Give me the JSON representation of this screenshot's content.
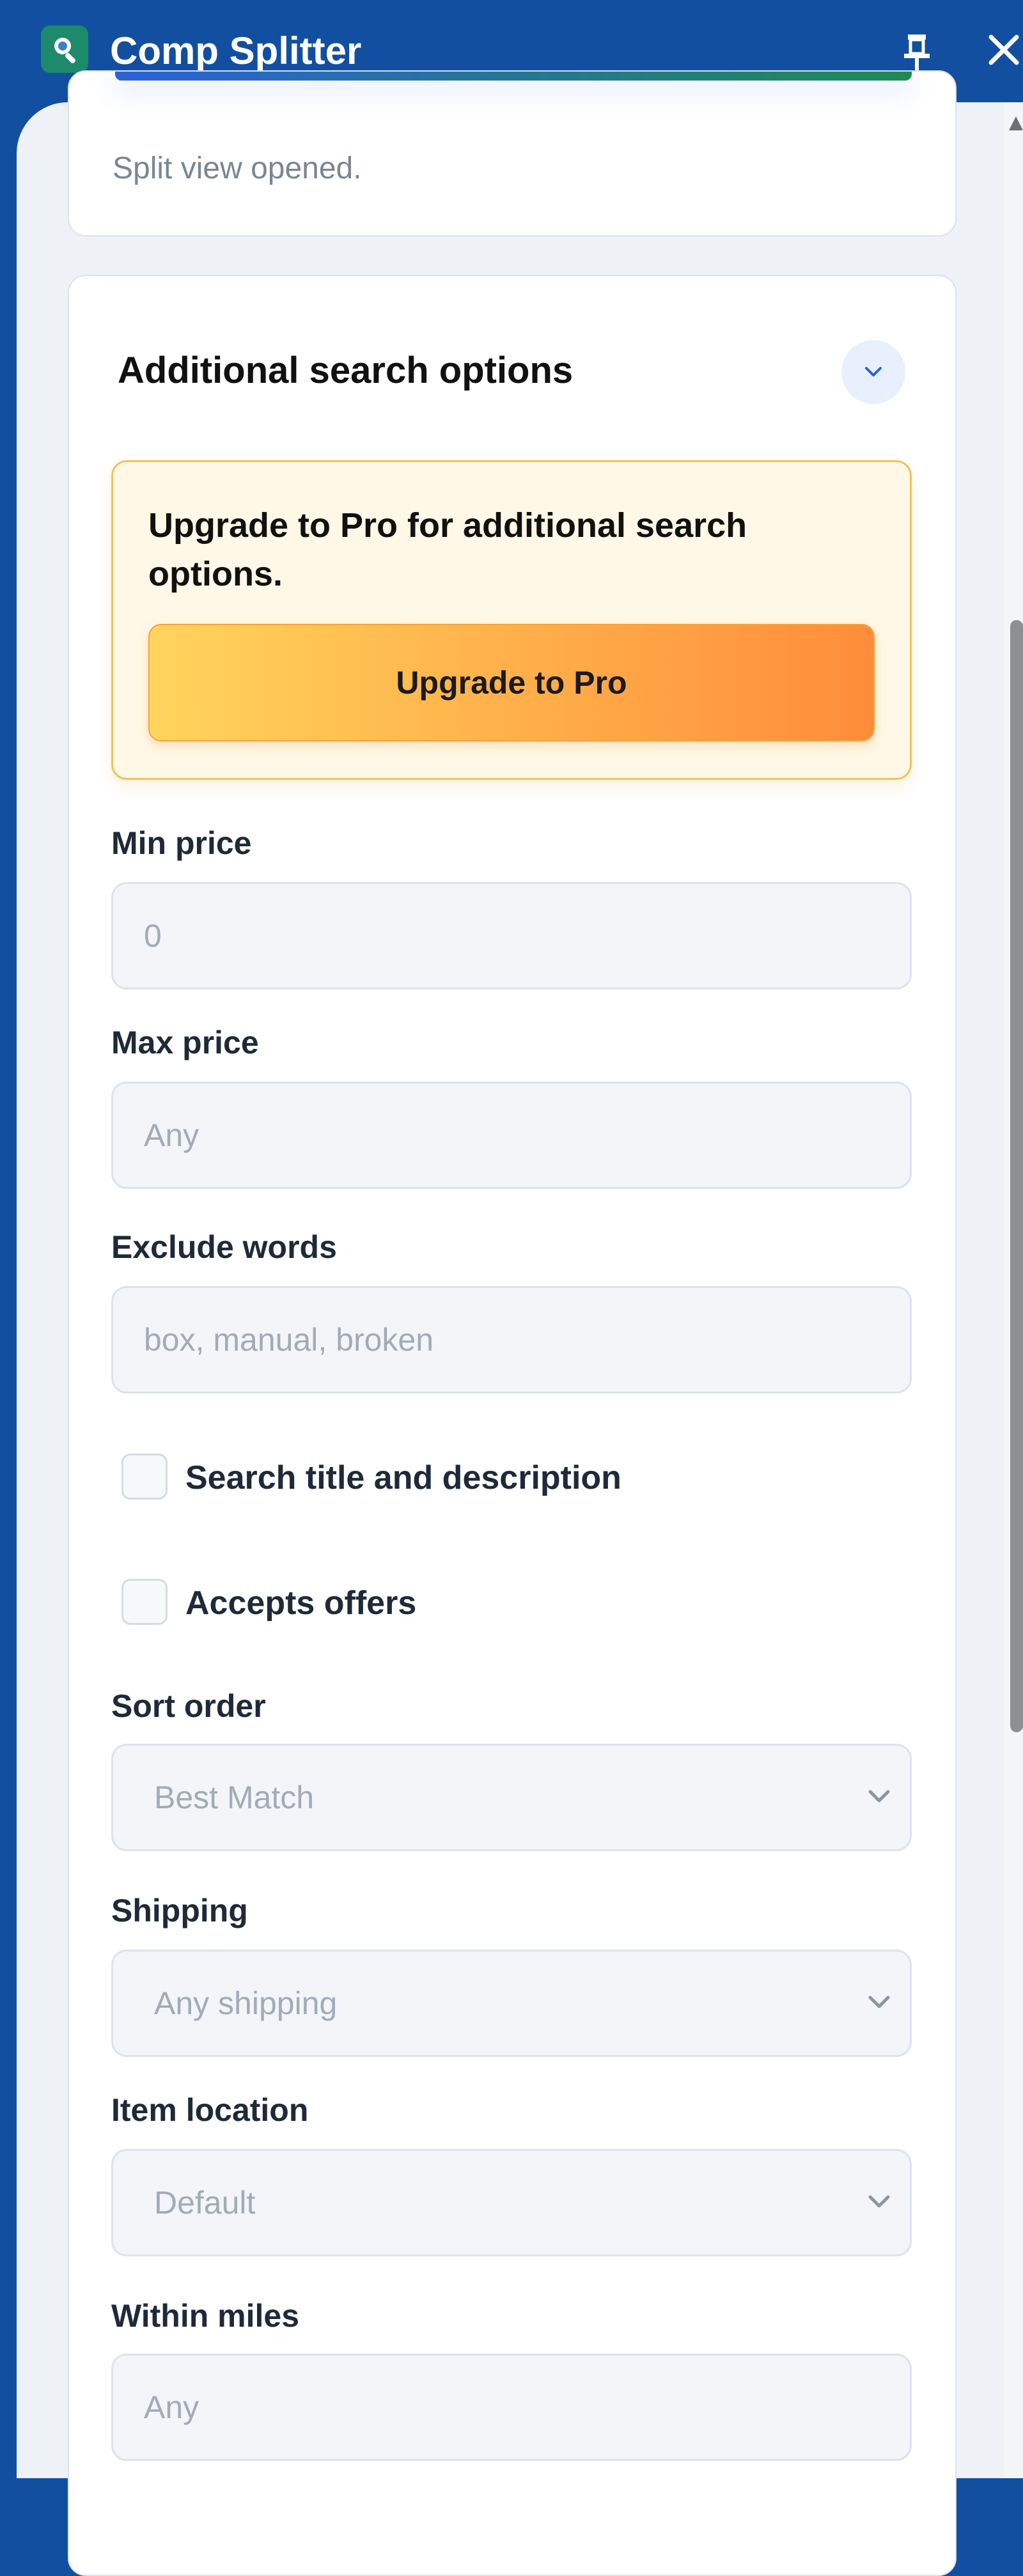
{
  "window": {
    "title": "Comp Splitter",
    "icons": {
      "app": "search-puzzle-icon",
      "pin": "pin-icon",
      "close": "close-icon"
    }
  },
  "status": {
    "message": "Split view opened."
  },
  "additional_options": {
    "title": "Additional search options",
    "promo": {
      "message": "Upgrade to Pro for additional search options.",
      "button_label": "Upgrade to Pro"
    },
    "min_price": {
      "label": "Min price",
      "placeholder": "0"
    },
    "max_price": {
      "label": "Max price",
      "placeholder": "Any"
    },
    "exclude_words": {
      "label": "Exclude words",
      "placeholder": "box, manual, broken"
    },
    "search_title_desc": {
      "label": "Search title and description",
      "checked": false
    },
    "accepts_offers": {
      "label": "Accepts offers",
      "checked": false
    },
    "sort_order": {
      "label": "Sort order",
      "value": "Best Match"
    },
    "shipping": {
      "label": "Shipping",
      "value": "Any shipping"
    },
    "item_location": {
      "label": "Item location",
      "value": "Default"
    },
    "within_miles": {
      "label": "Within miles",
      "placeholder": "Any"
    }
  },
  "colors": {
    "titlebar": "#134fa0",
    "accent_blue": "#2a62d6",
    "promo_bg": "#fff8e6",
    "promo_border": "#f2c25a",
    "button_gradient_start": "#ffd45c",
    "button_gradient_end": "#ff8c3a"
  }
}
